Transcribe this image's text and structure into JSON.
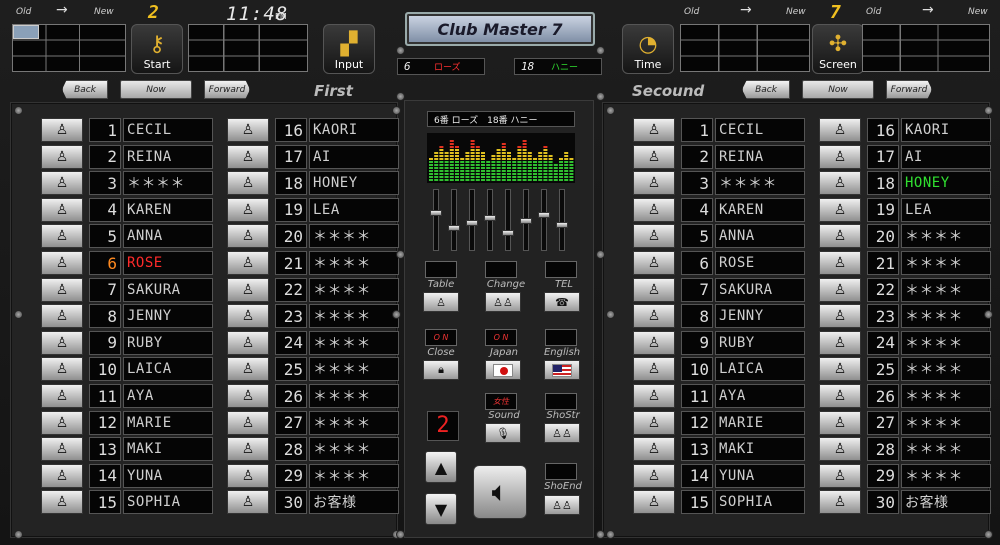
{
  "header": {
    "left": {
      "old_label": "Old",
      "arrow": "→",
      "new_label": "New",
      "table_no": "2"
    },
    "clock": {
      "time": "11:48",
      "ampm": "PM"
    },
    "title": "Club Master 7",
    "right": {
      "old_label": "Old",
      "arrow": "→",
      "new_label": "New",
      "table_no": "7",
      "old_label2": "Old",
      "arrow2": "→",
      "new_label2": "New"
    }
  },
  "toolbar": {
    "start_label": "Start",
    "input_label": "Input",
    "time_label": "Time",
    "screen_label": "Screen"
  },
  "nav_first": {
    "back": "Back",
    "now": "Now",
    "forward": "Forward",
    "section": "First"
  },
  "nav_second": {
    "back": "Back",
    "now": "Now",
    "forward": "Forward",
    "section": "Secound"
  },
  "pairs": [
    {
      "num": "6",
      "name": "ローズ",
      "color": "#ff3030"
    },
    {
      "num": "18",
      "name": "ハニー",
      "color": "#30e030"
    }
  ],
  "pair_display": "6番 ローズ　18番 ハニー",
  "controls": {
    "table": "Table",
    "change": "Change",
    "tel": "TEL",
    "close": "Close",
    "japan": "Japan",
    "english": "English",
    "sound": "Sound",
    "shostr": "ShoStr",
    "shoend": "ShoEnd",
    "on1": "O N",
    "on2": "O N",
    "female": "女性",
    "counter": "2"
  },
  "first_list": [
    {
      "n": "1",
      "name": "CECIL",
      "color": "#cfcfcf"
    },
    {
      "n": "2",
      "name": "REINA",
      "color": "#cfcfcf"
    },
    {
      "n": "3",
      "name": "＊＊＊＊",
      "color": "#cfcfcf"
    },
    {
      "n": "4",
      "name": "KAREN",
      "color": "#cfcfcf"
    },
    {
      "n": "5",
      "name": "ANNA",
      "color": "#cfcfcf"
    },
    {
      "n": "6",
      "name": "ROSE",
      "color": "#ff2a2a",
      "numcolor": "#ff8a20"
    },
    {
      "n": "7",
      "name": "SAKURA",
      "color": "#cfcfcf"
    },
    {
      "n": "8",
      "name": "JENNY",
      "color": "#cfcfcf"
    },
    {
      "n": "9",
      "name": "RUBY",
      "color": "#cfcfcf"
    },
    {
      "n": "10",
      "name": "LAICA",
      "color": "#cfcfcf"
    },
    {
      "n": "11",
      "name": "AYA",
      "color": "#cfcfcf"
    },
    {
      "n": "12",
      "name": "MARIE",
      "color": "#cfcfcf"
    },
    {
      "n": "13",
      "name": "MAKI",
      "color": "#cfcfcf"
    },
    {
      "n": "14",
      "name": "YUNA",
      "color": "#cfcfcf"
    },
    {
      "n": "15",
      "name": "SOPHIA",
      "color": "#cfcfcf"
    },
    {
      "n": "16",
      "name": "KAORI",
      "color": "#cfcfcf"
    },
    {
      "n": "17",
      "name": "AI",
      "color": "#cfcfcf"
    },
    {
      "n": "18",
      "name": "HONEY",
      "color": "#cfcfcf"
    },
    {
      "n": "19",
      "name": "LEA",
      "color": "#cfcfcf"
    },
    {
      "n": "20",
      "name": "＊＊＊＊",
      "color": "#cfcfcf"
    },
    {
      "n": "21",
      "name": "＊＊＊＊",
      "color": "#cfcfcf"
    },
    {
      "n": "22",
      "name": "＊＊＊＊",
      "color": "#cfcfcf"
    },
    {
      "n": "23",
      "name": "＊＊＊＊",
      "color": "#cfcfcf"
    },
    {
      "n": "24",
      "name": "＊＊＊＊",
      "color": "#cfcfcf"
    },
    {
      "n": "25",
      "name": "＊＊＊＊",
      "color": "#cfcfcf"
    },
    {
      "n": "26",
      "name": "＊＊＊＊",
      "color": "#cfcfcf"
    },
    {
      "n": "27",
      "name": "＊＊＊＊",
      "color": "#cfcfcf"
    },
    {
      "n": "28",
      "name": "＊＊＊＊",
      "color": "#cfcfcf"
    },
    {
      "n": "29",
      "name": "＊＊＊＊",
      "color": "#cfcfcf"
    },
    {
      "n": "30",
      "name": "お客様",
      "color": "#cfcfcf"
    }
  ],
  "second_list": [
    {
      "n": "1",
      "name": "CECIL",
      "color": "#cfcfcf"
    },
    {
      "n": "2",
      "name": "REINA",
      "color": "#cfcfcf"
    },
    {
      "n": "3",
      "name": "＊＊＊＊",
      "color": "#cfcfcf"
    },
    {
      "n": "4",
      "name": "KAREN",
      "color": "#cfcfcf"
    },
    {
      "n": "5",
      "name": "ANNA",
      "color": "#cfcfcf"
    },
    {
      "n": "6",
      "name": "ROSE",
      "color": "#cfcfcf"
    },
    {
      "n": "7",
      "name": "SAKURA",
      "color": "#cfcfcf"
    },
    {
      "n": "8",
      "name": "JENNY",
      "color": "#cfcfcf"
    },
    {
      "n": "9",
      "name": "RUBY",
      "color": "#cfcfcf"
    },
    {
      "n": "10",
      "name": "LAICA",
      "color": "#cfcfcf"
    },
    {
      "n": "11",
      "name": "AYA",
      "color": "#cfcfcf"
    },
    {
      "n": "12",
      "name": "MARIE",
      "color": "#cfcfcf"
    },
    {
      "n": "13",
      "name": "MAKI",
      "color": "#cfcfcf"
    },
    {
      "n": "14",
      "name": "YUNA",
      "color": "#cfcfcf"
    },
    {
      "n": "15",
      "name": "SOPHIA",
      "color": "#cfcfcf"
    },
    {
      "n": "16",
      "name": "KAORI",
      "color": "#cfcfcf"
    },
    {
      "n": "17",
      "name": "AI",
      "color": "#cfcfcf"
    },
    {
      "n": "18",
      "name": "HONEY",
      "color": "#30e030"
    },
    {
      "n": "19",
      "name": "LEA",
      "color": "#cfcfcf"
    },
    {
      "n": "20",
      "name": "＊＊＊＊",
      "color": "#cfcfcf"
    },
    {
      "n": "21",
      "name": "＊＊＊＊",
      "color": "#cfcfcf"
    },
    {
      "n": "22",
      "name": "＊＊＊＊",
      "color": "#cfcfcf"
    },
    {
      "n": "23",
      "name": "＊＊＊＊",
      "color": "#cfcfcf"
    },
    {
      "n": "24",
      "name": "＊＊＊＊",
      "color": "#cfcfcf"
    },
    {
      "n": "25",
      "name": "＊＊＊＊",
      "color": "#cfcfcf"
    },
    {
      "n": "26",
      "name": "＊＊＊＊",
      "color": "#cfcfcf"
    },
    {
      "n": "27",
      "name": "＊＊＊＊",
      "color": "#cfcfcf"
    },
    {
      "n": "28",
      "name": "＊＊＊＊",
      "color": "#cfcfcf"
    },
    {
      "n": "29",
      "name": "＊＊＊＊",
      "color": "#cfcfcf"
    },
    {
      "n": "30",
      "name": "お客様",
      "color": "#cfcfcf"
    }
  ]
}
